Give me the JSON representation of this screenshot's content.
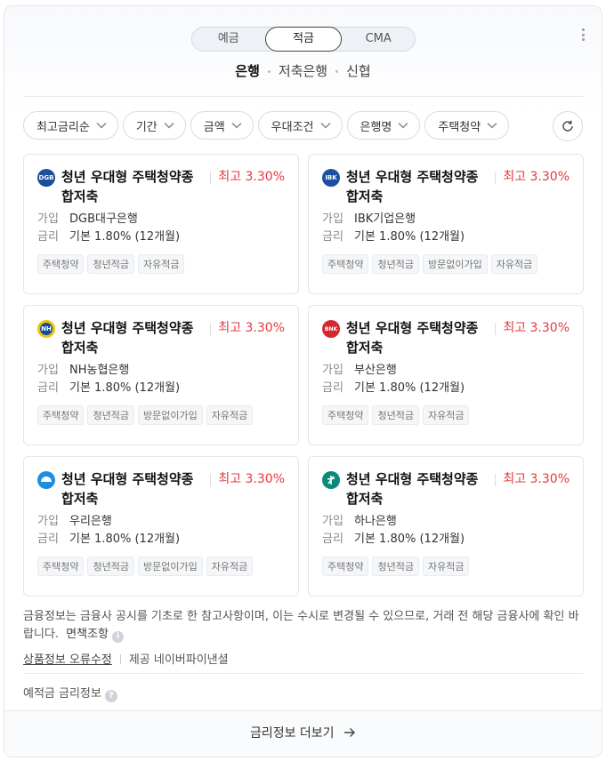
{
  "segment_tabs": [
    {
      "label": "예금",
      "active": false
    },
    {
      "label": "적금",
      "active": true
    },
    {
      "label": "CMA",
      "active": false
    }
  ],
  "sub_tabs": [
    {
      "label": "은행",
      "active": true
    },
    {
      "label": "저축은행",
      "active": false
    },
    {
      "label": "신협",
      "active": false
    }
  ],
  "filters": [
    "최고금리순",
    "기간",
    "금액",
    "우대조건",
    "은행명",
    "주택청약"
  ],
  "labels": {
    "join": "가입",
    "rate": "금리"
  },
  "cards": [
    {
      "title": "청년 우대형 주택청약종합저축",
      "max_rate": "최고 3.30%",
      "bank": "DGB대구은행",
      "base_rate": "기본 1.80% (12개월)",
      "tags": [
        "주택청약",
        "청년적금",
        "자유적금"
      ],
      "logo_color": "#1d4f9c",
      "logo_text": "DGB"
    },
    {
      "title": "청년 우대형 주택청약종합저축",
      "max_rate": "최고 3.30%",
      "bank": "IBK기업은행",
      "base_rate": "기본 1.80% (12개월)",
      "tags": [
        "주택청약",
        "청년적금",
        "방문없이가입",
        "자유적금"
      ],
      "logo_color": "#1b4fa0",
      "logo_text": "IBK"
    },
    {
      "title": "청년 우대형 주택청약종합저축",
      "max_rate": "최고 3.30%",
      "bank": "NH농협은행",
      "base_rate": "기본 1.80% (12개월)",
      "tags": [
        "주택청약",
        "청년적금",
        "방문없이가입",
        "자유적금"
      ],
      "logo_color": "#0e4ea1",
      "logo_text": "NH"
    },
    {
      "title": "청년 우대형 주택청약종합저축",
      "max_rate": "최고 3.30%",
      "bank": "부산은행",
      "base_rate": "기본 1.80% (12개월)",
      "tags": [
        "주택청약",
        "청년적금",
        "자유적금"
      ],
      "logo_color": "#d7262f",
      "logo_text": "BNK"
    },
    {
      "title": "청년 우대형 주택청약종합저축",
      "max_rate": "최고 3.30%",
      "bank": "우리은행",
      "base_rate": "기본 1.80% (12개월)",
      "tags": [
        "주택청약",
        "청년적금",
        "방문없이가입",
        "자유적금"
      ],
      "logo_color": "#1e8fdc",
      "logo_text": ""
    },
    {
      "title": "청년 우대형 주택청약종합저축",
      "max_rate": "최고 3.30%",
      "bank": "하나은행",
      "base_rate": "기본 1.80% (12개월)",
      "tags": [
        "주택청약",
        "청년적금",
        "자유적금"
      ],
      "logo_color": "#0a8a7a",
      "logo_text": ""
    }
  ],
  "notice": {
    "text": "금융정보는 금융사 공시를 기초로 한 참고사항이며, 이는 수시로 변경될 수 있으므로, 거래 전 해당 금융사에 확인 바랍니다.",
    "disclaimer": "면책조항",
    "error_link": "상품정보 오류수정",
    "provider": "제공 네이버파이낸셜"
  },
  "rate_info_label": "예적금 금리정보",
  "more_button": "금리정보 더보기"
}
